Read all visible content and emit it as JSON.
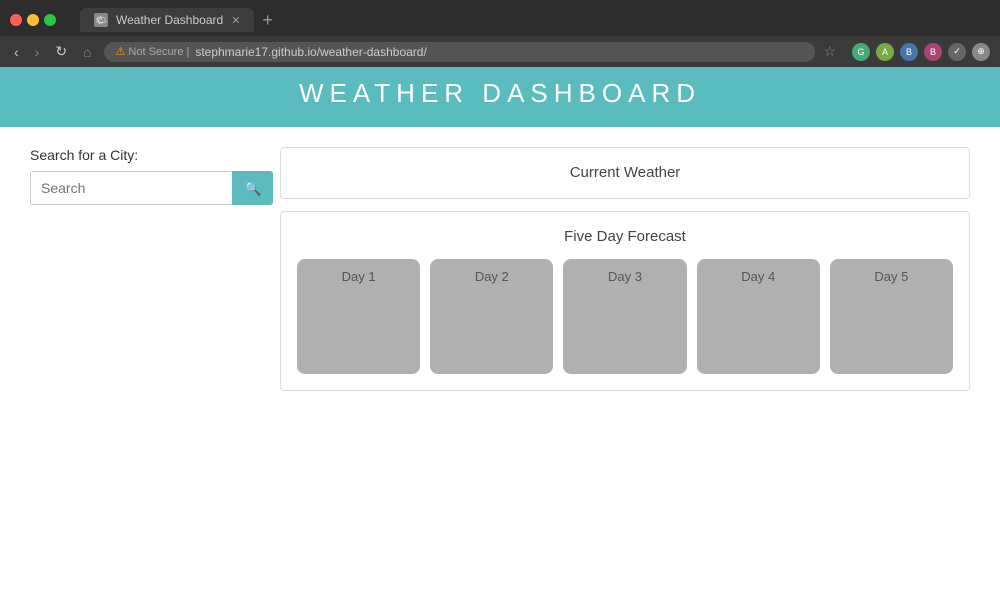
{
  "browser": {
    "tab_title": "Weather Dashboard",
    "new_tab_btn": "+",
    "nav": {
      "back": "‹",
      "forward": "›",
      "reload": "↻",
      "home": "⌂"
    },
    "security_label": "Not Secure",
    "url": "stephmarie17.github.io/weather-dashboard/",
    "star_icon": "☆"
  },
  "page": {
    "header_title": "WEATHER DASHBOARD",
    "search_label": "Search for a City:",
    "search_placeholder": "Search",
    "current_weather_title": "Current Weather",
    "forecast_title": "Five Day Forecast",
    "forecast_days": [
      {
        "label": "Day 1"
      },
      {
        "label": "Day 2"
      },
      {
        "label": "Day 3"
      },
      {
        "label": "Day 4"
      },
      {
        "label": "Day 5"
      }
    ]
  },
  "colors": {
    "header_bg": "#5bbcbf",
    "search_btn": "#5bbcbf",
    "card_bg": "#b0b0b0"
  }
}
